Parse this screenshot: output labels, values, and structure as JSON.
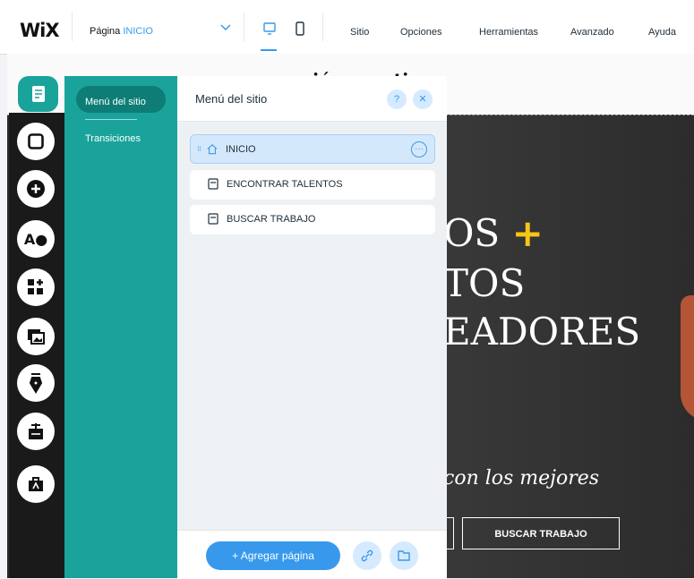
{
  "topbar": {
    "logo": "WiX",
    "page_prefix": "Página",
    "page_name": "INICIO",
    "menu": [
      "Sitio",
      "Opciones",
      "Herramientas",
      "Avanzado",
      "Ayuda"
    ]
  },
  "canvas": {
    "partial_title": "...ión creativo",
    "hero_lines": [
      "OS",
      "TOS",
      "EADORES"
    ],
    "tagline": "con los mejores",
    "button_left": "",
    "button_right": "BUSCAR TRABAJO"
  },
  "left_panel": {
    "items": [
      "Menú del sitio",
      "Transiciones"
    ],
    "active_index": 0
  },
  "site_menu": {
    "title": "Menú del sitio",
    "help": "?",
    "close": "✕",
    "pages": [
      {
        "label": "INICIO",
        "home": true,
        "active": true
      },
      {
        "label": "ENCONTRAR TALENTOS",
        "home": false,
        "active": false
      },
      {
        "label": "BUSCAR TRABAJO",
        "home": false,
        "active": false
      }
    ],
    "more": "···",
    "add_page": "+ Agregar página"
  },
  "colors": {
    "accent": "#3899ec",
    "teal": "#1aa39b",
    "yellow_plus": "#f5c518"
  }
}
